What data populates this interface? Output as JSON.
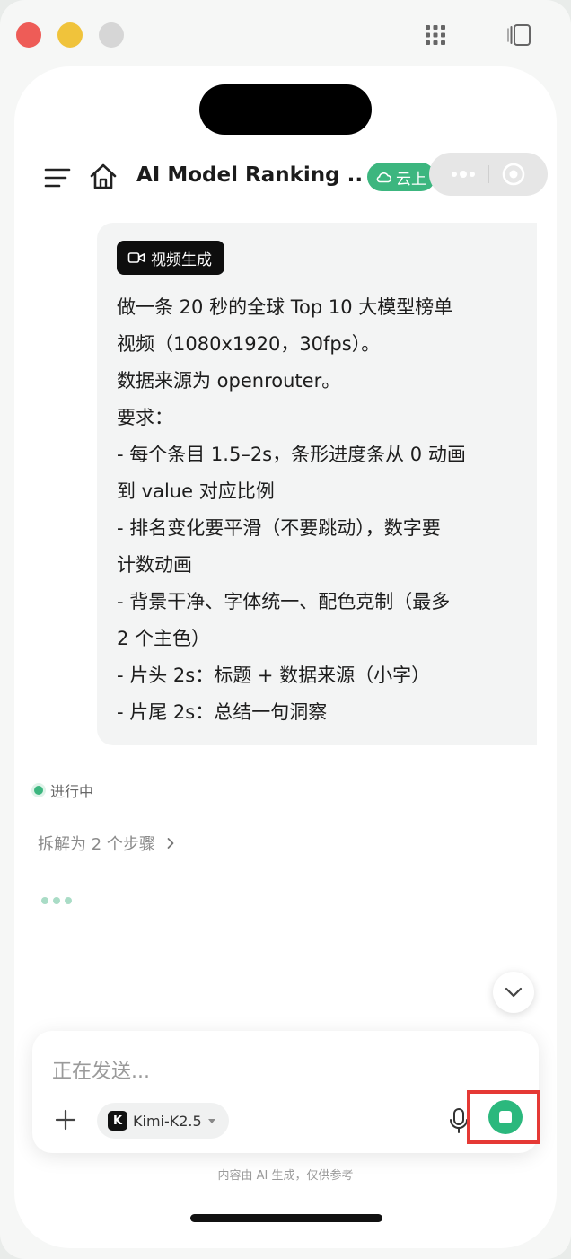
{
  "header": {
    "title": "AI Model Ranking ...",
    "cloud_badge": "云上"
  },
  "message": {
    "tag": "视频生成",
    "lines": [
      "做一条 20 秒的全球 Top 10 大模型榜单",
      "视频（1080x1920，30fps）。",
      "数据来源为 openrouter。",
      "要求：",
      "- 每个条目 1.5–2s，条形进度条从 0 动画",
      "到 value 对应比例",
      "- 排名变化要平滑（不要跳动），数字要",
      "计数动画",
      "- 背景干净、字体统一、配色克制（最多",
      "2 个主色）",
      "- 片头 2s：标题 + 数据来源（小字）",
      "- 片尾 2s：总结一句洞察"
    ]
  },
  "status": {
    "text": "进行中",
    "steps": "拆解为 2 个步骤"
  },
  "composer": {
    "placeholder": "正在发送...",
    "model": "Kimi-K2.5",
    "model_logo": "K"
  },
  "disclaimer": "内容由 AI 生成，仅供参考",
  "colors": {
    "accent": "#3cb67f",
    "stop": "#2bb87d",
    "highlight": "#e53935"
  }
}
